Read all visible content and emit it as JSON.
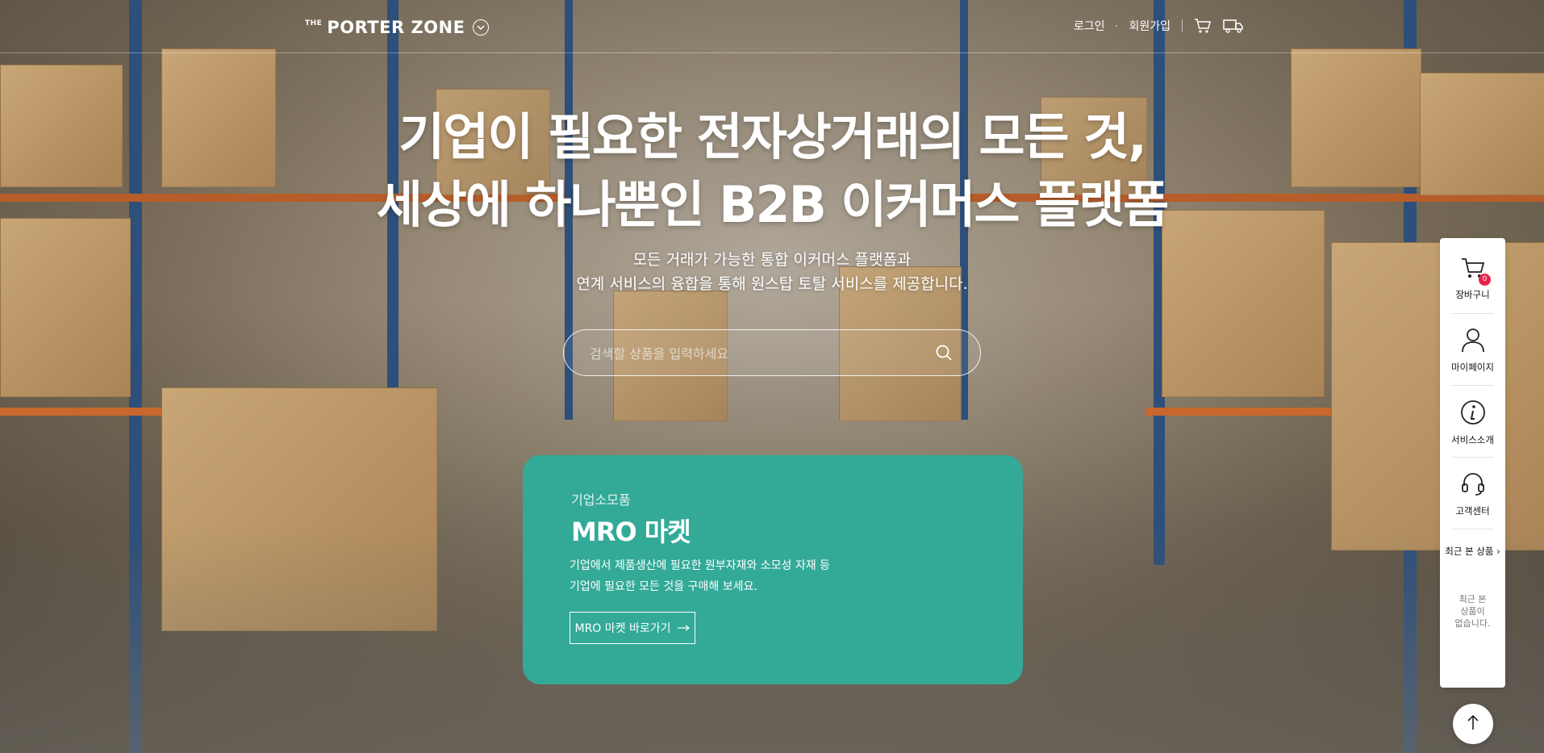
{
  "header": {
    "logo_the": "THE",
    "logo_name": "PORTER ZONE",
    "login": "로그인",
    "signup": "회원가입"
  },
  "hero": {
    "title_line1": "기업이 필요한 전자상거래의 모든 것,",
    "title_line2": "세상에 하나뿐인 B2B 이커머스 플랫폼",
    "sub_line1": "모든 거래가 가능한 통합 이커머스 플랫폼과",
    "sub_line2": "연계 서비스의 융합을 통해 원스탑 토탈 서비스를 제공합니다."
  },
  "search": {
    "placeholder": "검색할 상품을 입력하세요"
  },
  "mro_card": {
    "kicker": "기업소모품",
    "title": "MRO 마켓",
    "desc_line1": "기업에서 제품생산에 필요한 원부자재와 소모성 자재 등",
    "desc_line2": "기업에 필요한 모든 것을 구매해 보세요.",
    "button": "MRO 마켓 바로가기",
    "color": "#33aa98"
  },
  "quick_menu": {
    "cart_label": "장바구니",
    "cart_count": "0",
    "mypage_label": "마이페이지",
    "service_label": "서비스소개",
    "support_label": "고객센터",
    "recent_label": "최근 본 상품",
    "recent_empty_1": "최근 본",
    "recent_empty_2": "상품이",
    "recent_empty_3": "없습니다."
  },
  "icons": [
    "chevron-down-icon",
    "cart-icon",
    "truck-icon",
    "search-icon",
    "arrow-right-icon",
    "user-icon",
    "info-icon",
    "headset-icon",
    "arrow-up-icon"
  ]
}
